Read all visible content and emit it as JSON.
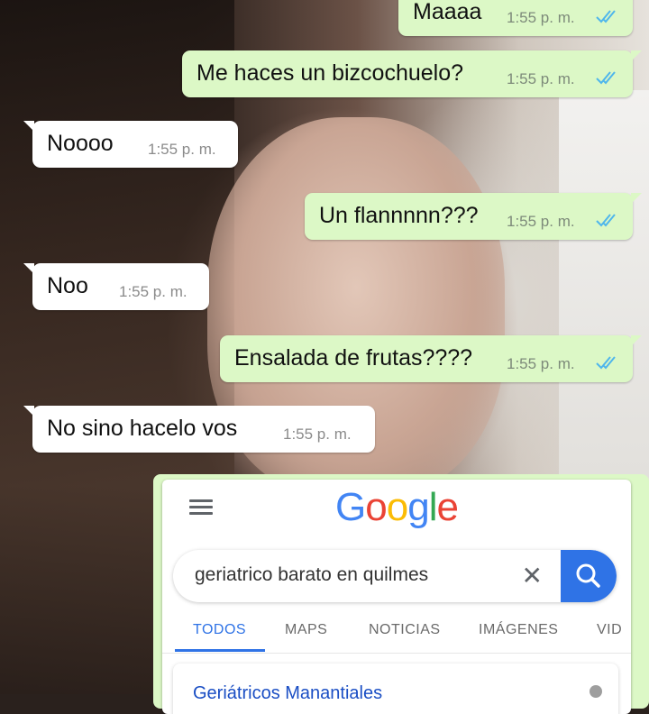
{
  "chat": {
    "messages": [
      {
        "direction": "out",
        "text": "Maaaa",
        "time": "1:55 p. m.",
        "read": true
      },
      {
        "direction": "out",
        "text": "Me haces un bizcochuelo?",
        "time": "1:55 p. m.",
        "read": true
      },
      {
        "direction": "in",
        "text": "Noooo",
        "time": "1:55 p. m."
      },
      {
        "direction": "out",
        "text": "Un flannnnn???",
        "time": "1:55 p. m.",
        "read": true
      },
      {
        "direction": "in",
        "text": "Noo",
        "time": "1:55 p. m."
      },
      {
        "direction": "out",
        "text": "Ensalada de frutas????",
        "time": "1:55 p. m.",
        "read": true
      },
      {
        "direction": "in",
        "text": "No sino hacelo vos",
        "time": "1:55 p. m."
      }
    ],
    "colors": {
      "outgoing": "#dcf8c6",
      "incoming": "#ffffff",
      "ticks": "#4fb6ec"
    }
  },
  "google": {
    "logo": [
      "G",
      "o",
      "o",
      "g",
      "l",
      "e"
    ],
    "logo_colors": [
      "#4285f4",
      "#ea4335",
      "#fbbc05",
      "#4285f4",
      "#34a853",
      "#ea4335"
    ],
    "search_query": "geriatrico barato en quilmes",
    "tabs": [
      "TODOS",
      "MAPS",
      "NOTICIAS",
      "IMÁGENES",
      "VID"
    ],
    "active_tab": "TODOS",
    "first_result_title": "Geriátricos Manantiales",
    "accent": "#2f73e6",
    "icons": {
      "menu": "hamburger-menu-icon",
      "clear": "close-icon",
      "search": "search-icon"
    }
  }
}
